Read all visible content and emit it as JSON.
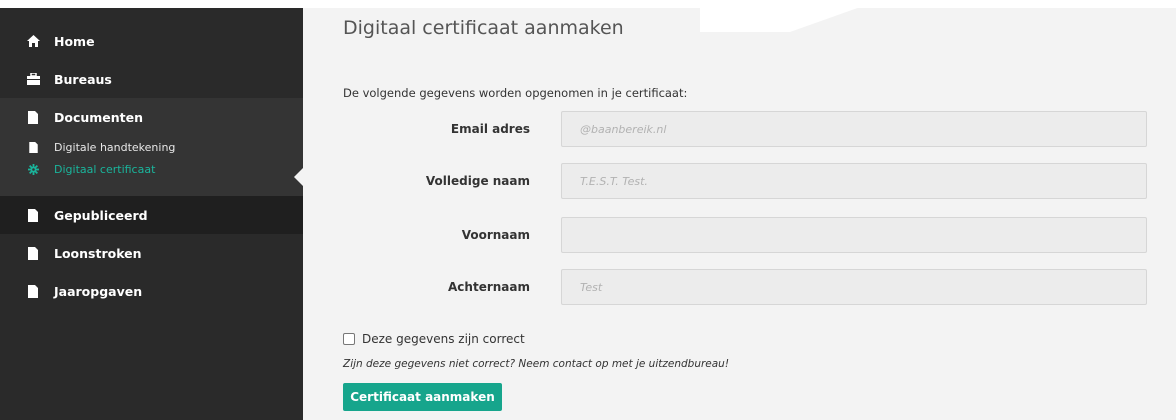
{
  "sidebar": {
    "items": [
      {
        "label": "Home",
        "icon": "home-icon"
      },
      {
        "label": "Bureaus",
        "icon": "briefcase-icon"
      },
      {
        "label": "Documenten",
        "icon": "document-icon"
      },
      {
        "label": "Gepubliceerd",
        "icon": "document-icon"
      },
      {
        "label": "Loonstroken",
        "icon": "document-icon"
      },
      {
        "label": "Jaaropgaven",
        "icon": "document-icon"
      }
    ],
    "subitems": [
      {
        "label": "Digitale handtekening",
        "icon": "document-icon"
      },
      {
        "label": "Digitaal certificaat",
        "icon": "gear-icon",
        "active": true
      }
    ]
  },
  "main": {
    "title": "Digitaal certificaat aanmaken",
    "intro": "De volgende gegevens worden opgenomen in je certificaat:",
    "fields": [
      {
        "label": "Email adres",
        "placeholder": "@baanbereik.nl"
      },
      {
        "label": "Volledige naam",
        "placeholder": "T.E.S.T. Test."
      },
      {
        "label": "Voornaam",
        "placeholder": ""
      },
      {
        "label": "Achternaam",
        "placeholder": "Test"
      }
    ],
    "checkbox_label": "Deze gegevens zijn correct",
    "notice": "Zijn deze gegevens niet correct? Neem contact op met je uitzendbureau!",
    "submit_label": "Certificaat aanmaken"
  },
  "colors": {
    "accent": "#16a58c",
    "sidebar_bg": "#2a2a2a",
    "content_bg": "#f3f3f3"
  }
}
